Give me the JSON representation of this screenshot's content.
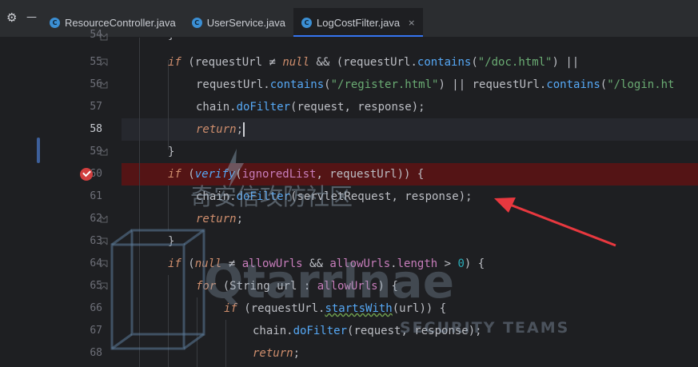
{
  "tabs": [
    {
      "icon": "C",
      "label": "ResourceController.java",
      "active": false
    },
    {
      "icon": "C",
      "label": "UserService.java",
      "active": false
    },
    {
      "icon": "C",
      "label": "LogCostFilter.java",
      "active": true,
      "close": "×"
    }
  ],
  "toolbar": {
    "settings_glyph": "⚙",
    "collapse_glyph": "—"
  },
  "gutter": {
    "partial_line": "54",
    "lines": [
      "55",
      "56",
      "57",
      "58",
      "59",
      "60",
      "61",
      "62",
      "63",
      "64",
      "65",
      "66",
      "67",
      "68"
    ],
    "current_line": "58",
    "breakpoint_line": "60"
  },
  "code": {
    "l54": "}",
    "l55": [
      "if",
      " (requestUrl ",
      "≠",
      " ",
      "null",
      " && (requestUrl.",
      "contains",
      "(",
      "\"/doc.html\"",
      ") ||"
    ],
    "l56": [
      "requestUrl.",
      "contains",
      "(",
      "\"/register.html\"",
      ") || requestUrl.",
      "contains",
      "(",
      "\"/login.ht"
    ],
    "l57": [
      "chain.",
      "doFilter",
      "(request, response);"
    ],
    "l58": [
      "return",
      ";"
    ],
    "l59": "}",
    "l60": [
      "if",
      " (",
      "verify",
      "(",
      "ignoredList",
      ", requestUrl)) {"
    ],
    "l61": [
      "chain.",
      "doFilter",
      "(servletRequest, response);"
    ],
    "l62": [
      "return",
      ";"
    ],
    "l63": "}",
    "l64": [
      "if",
      " (",
      "null",
      " ≠ ",
      "allowUrls",
      " && ",
      "allowUrls",
      ".",
      "length",
      " > ",
      "0",
      ") {"
    ],
    "l65": [
      "for",
      " (String url : ",
      "allowUrls",
      ") {"
    ],
    "l66": [
      "if",
      " (requestUrl.",
      "startsWith",
      "(url)) {"
    ],
    "l67": [
      "chain.",
      "doFilter",
      "(request, response);"
    ],
    "l68": [
      "return",
      ";"
    ]
  },
  "watermark": {
    "cn": "奇安信攻防社区",
    "brand": "Qtarrlnae",
    "teams": "SECURITY TEAMS"
  },
  "colors": {
    "editor_bg": "#1e1f22",
    "keyword": "#cf8e6d",
    "string": "#6aab73",
    "method": "#56a8f5",
    "field": "#c77dbb",
    "number": "#2aacb8",
    "breakpoint_line": "#6a1010",
    "arrow": "#e8383f"
  }
}
